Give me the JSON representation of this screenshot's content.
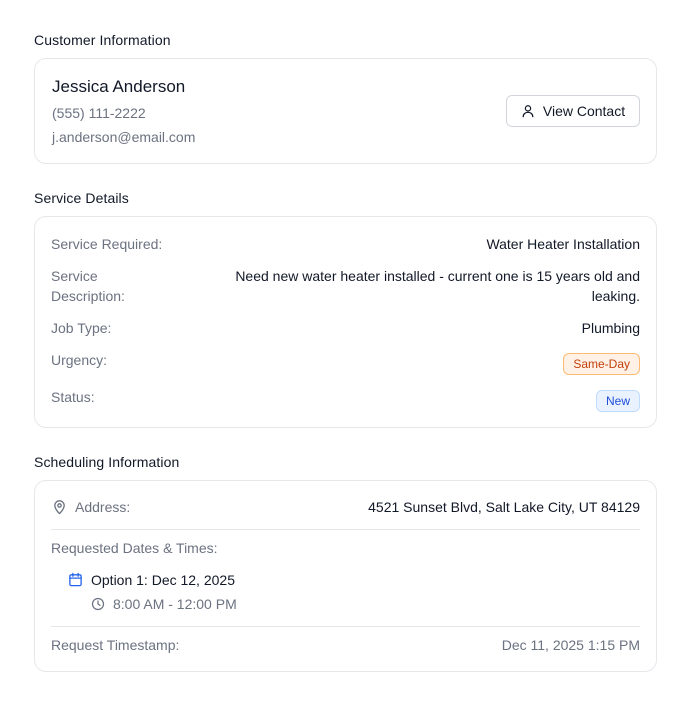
{
  "customer": {
    "section_title": "Customer Information",
    "name": "Jessica Anderson",
    "phone": "(555) 111-2222",
    "email": "j.anderson@email.com",
    "view_contact_label": "View Contact"
  },
  "service": {
    "section_title": "Service Details",
    "required_label": "Service Required:",
    "required_value": "Water Heater Installation",
    "description_label_line1": "Service",
    "description_label_line2": "Description:",
    "description_value_line1": "Need new water heater installed - current one is 15 years old and",
    "description_value_line2": "leaking.",
    "job_type_label": "Job Type:",
    "job_type_value": "Plumbing",
    "urgency_label": "Urgency:",
    "urgency_value": "Same-Day",
    "status_label": "Status:",
    "status_value": "New"
  },
  "scheduling": {
    "section_title": "Scheduling Information",
    "address_label": "Address:",
    "address_value": "4521 Sunset Blvd, Salt Lake City, UT 84129",
    "requested_label": "Requested Dates & Times:",
    "options": [
      {
        "label": "Option 1: Dec 12, 2025",
        "time": "8:00 AM - 12:00 PM"
      }
    ],
    "timestamp_label": "Request Timestamp:",
    "timestamp_value": "Dec 11, 2025 1:15 PM"
  },
  "colors": {
    "accent_blue": "#2563eb",
    "badge_orange_text": "#c2410c",
    "badge_blue_text": "#1d4ed8"
  },
  "icons": [
    "user-icon",
    "map-pin-icon",
    "calendar-icon",
    "clock-icon"
  ]
}
